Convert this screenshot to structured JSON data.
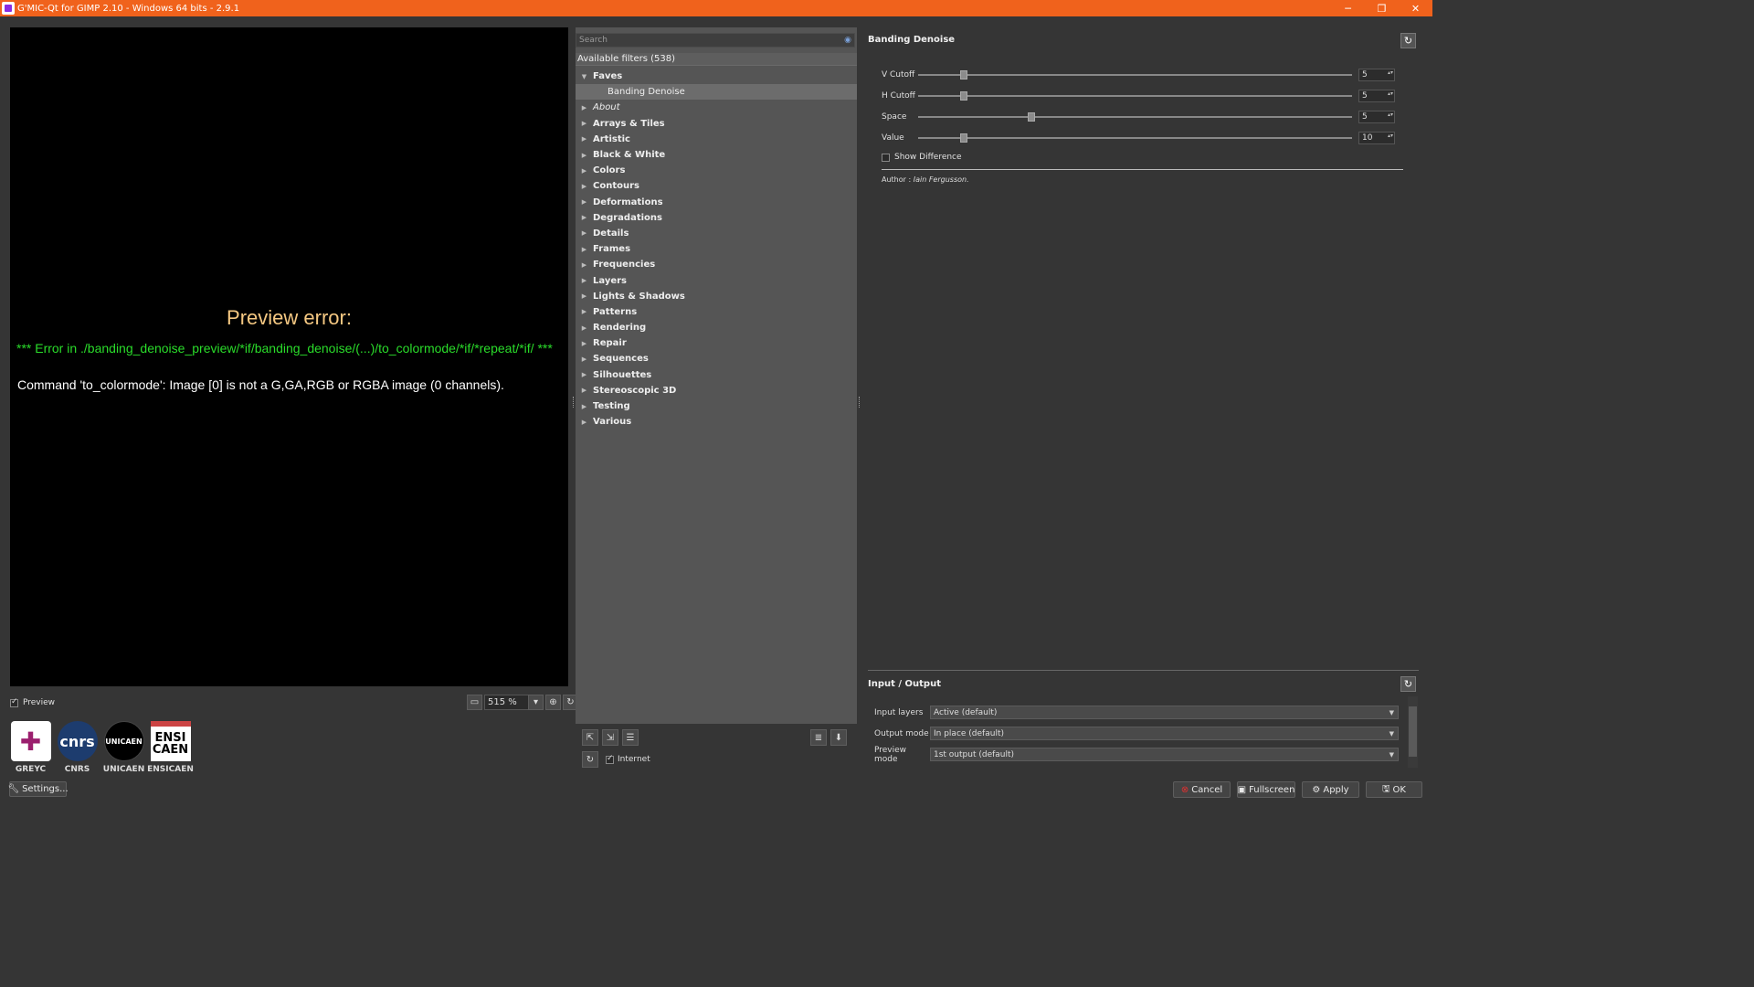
{
  "window": {
    "title": "G'MIC-Qt for GIMP 2.10 - Windows 64 bits - 2.9.1",
    "controls": [
      "─",
      "❐",
      "✕"
    ]
  },
  "preview": {
    "error_title": "Preview error:",
    "error_path": "*** Error in ./banding_denoise_preview/*if/banding_denoise/(...)/to_colormode/*if/*repeat/*if/ ***",
    "error_message": "Command 'to_colormode': Image [0] is not a G,GA,RGB or RGBA image (0 channels).",
    "checkbox_label": "Preview",
    "checkbox_checked": true,
    "zoom_value": "515 %"
  },
  "logos": [
    {
      "name": "GREYC",
      "mark": "✚",
      "bg": "#9b1f6e"
    },
    {
      "name": "CNRS",
      "mark": "cnrs",
      "bg": "#1d3c6e"
    },
    {
      "name": "UNICAEN",
      "mark": "UNICAEN",
      "bg": "#000000"
    },
    {
      "name": "ENSICAEN",
      "mark": "ENSI CAEN",
      "bg": "#ffffff"
    }
  ],
  "settings_button": "Settings...",
  "filters": {
    "search_placeholder": "Search",
    "available": "Available filters (538)",
    "tree": [
      {
        "label": "Faves",
        "expanded": true
      },
      {
        "label": "Banding Denoise",
        "child": true,
        "selected": true
      },
      {
        "label": "About",
        "italic": true
      },
      {
        "label": "Arrays & Tiles"
      },
      {
        "label": "Artistic"
      },
      {
        "label": "Black & White"
      },
      {
        "label": "Colors"
      },
      {
        "label": "Contours"
      },
      {
        "label": "Deformations"
      },
      {
        "label": "Degradations"
      },
      {
        "label": "Details"
      },
      {
        "label": "Frames"
      },
      {
        "label": "Frequencies"
      },
      {
        "label": "Layers"
      },
      {
        "label": "Lights & Shadows"
      },
      {
        "label": "Patterns"
      },
      {
        "label": "Rendering"
      },
      {
        "label": "Repair"
      },
      {
        "label": "Sequences"
      },
      {
        "label": "Silhouettes"
      },
      {
        "label": "Stereoscopic 3D"
      },
      {
        "label": "Testing"
      },
      {
        "label": "Various"
      }
    ],
    "internet_label": "Internet",
    "internet_checked": true
  },
  "params": {
    "title": "Banding Denoise",
    "rows": [
      {
        "label": "V Cutoff",
        "value": "5",
        "level": 0.106
      },
      {
        "label": "H Cutoff",
        "value": "5",
        "level": 0.106
      },
      {
        "label": "Space",
        "value": "5",
        "level": 0.26
      },
      {
        "label": "Value",
        "value": "10",
        "level": 0.106
      }
    ],
    "show_difference": "Show Difference",
    "author_prefix": "Author : ",
    "author_name": "Iain Fergusson."
  },
  "io": {
    "title": "Input / Output",
    "rows": [
      {
        "label": "Input layers",
        "value": "Active (default)"
      },
      {
        "label": "Output mode",
        "value": "In place (default)"
      },
      {
        "label": "Preview mode",
        "value": "1st output (default)"
      }
    ]
  },
  "buttons": {
    "cancel": "Cancel",
    "fullscreen": "Fullscreen",
    "apply": "Apply",
    "ok": "OK"
  }
}
